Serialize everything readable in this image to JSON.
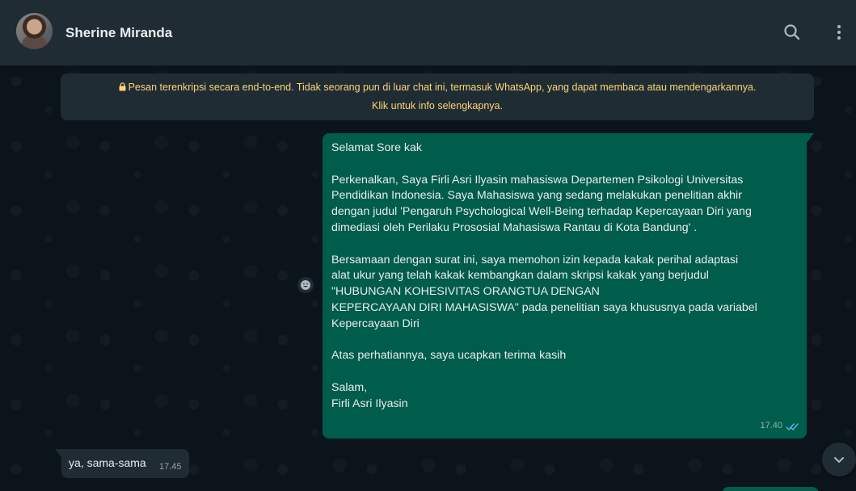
{
  "header": {
    "contact_name": "Sherine Miranda",
    "icons": [
      "search-icon",
      "menu-icon"
    ]
  },
  "encryption_banner": {
    "line1": "Pesan terenkripsi secara end-to-end. Tidak seorang pun di luar chat ini, termasuk WhatsApp, yang dapat membaca atau mendengarkannya.",
    "line2": "Klik untuk info selengkapnya."
  },
  "messages": {
    "outgoing": {
      "lines": [
        "Selamat Sore kak",
        "",
        "Perkenalkan, Saya Firli Asri Ilyasin mahasiswa Departemen Psikologi Universitas",
        "Pendidikan Indonesia. Saya Mahasiswa yang sedang melakukan penelitian akhir",
        "dengan judul 'Pengaruh Psychological Well-Being terhadap Kepercayaan Diri yang",
        "dimediasi oleh Perilaku Prososial Mahasiswa Rantau di Kota Bandung' .",
        "",
        "Bersamaan dengan surat ini, saya memohon izin kepada kakak perihal adaptasi",
        "alat ukur yang telah kakak kembangkan dalam skripsi kakak yang berjudul",
        "\"HUBUNGAN KOHESIVITAS ORANGTUA DENGAN",
        "KEPERCAYAAN DIRI MAHASISWA\" pada penelitian saya khususnya pada variabel",
        "Kepercayaan Diri",
        "",
        "Atas perhatiannya, saya ucapkan terima kasih",
        "",
        "Salam,",
        "Firli Asri Ilyasin"
      ],
      "time": "17.40",
      "status": "double-check-icon"
    },
    "incoming": {
      "text": "ya, sama-sama",
      "time": "17.45"
    }
  },
  "colors": {
    "header_bg": "#202c33",
    "chat_bg": "#0b141a",
    "outgoing_bubble": "#005c4b",
    "incoming_bubble": "#202c33",
    "banner_text": "#ffd279",
    "read_tick": "#53bdeb"
  }
}
